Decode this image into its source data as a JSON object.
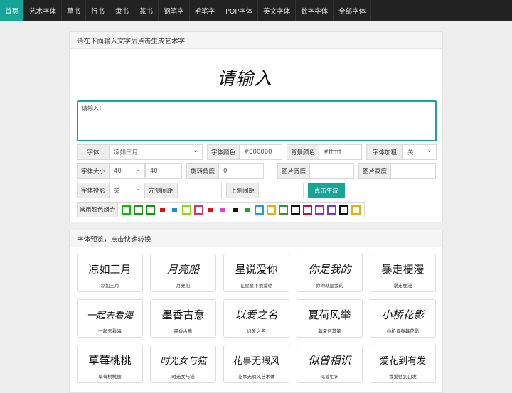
{
  "nav": {
    "items": [
      {
        "label": "首页",
        "active": true
      },
      {
        "label": "艺术字体",
        "active": false
      },
      {
        "label": "草书",
        "active": false
      },
      {
        "label": "行书",
        "active": false
      },
      {
        "label": "隶书",
        "active": false
      },
      {
        "label": "篆书",
        "active": false
      },
      {
        "label": "钢笔字",
        "active": false
      },
      {
        "label": "毛笔字",
        "active": false
      },
      {
        "label": "POP字体",
        "active": false
      },
      {
        "label": "英文字体",
        "active": false
      },
      {
        "label": "数字字体",
        "active": false
      },
      {
        "label": "全部字体",
        "active": false
      }
    ]
  },
  "generator": {
    "heading": "请在下面输入文字后点击生成艺术字",
    "preview_text": "请输入",
    "input_placeholder": "请输入！",
    "font_label": "字体",
    "font_value": "凉如三月",
    "font_color_label": "字体颜色",
    "font_color_value": "#000000",
    "bg_color_label": "背景颜色",
    "bg_color_value": "#ffffff",
    "bold_label": "字体加粗",
    "bold_value": "关",
    "size_label": "字体大小",
    "size_select": "40",
    "size_value": "40",
    "rotate_label": "旋转角度",
    "rotate_value": "0",
    "img_width_label": "图片宽度",
    "img_width_value": "",
    "img_height_label": "图片高度",
    "img_height_value": "",
    "shadow_label": "字体投影",
    "shadow_value": "关",
    "left_spacing_label": "左侧间距",
    "left_spacing_value": "",
    "top_spacing_label": "上侧间距",
    "top_spacing_value": "",
    "generate_button": "点击生成",
    "combo_label": "常用颜色组合",
    "swatches": [
      {
        "kind": "box",
        "color": "#00c000"
      },
      {
        "kind": "box",
        "color": "#1a9a1a"
      },
      {
        "kind": "box",
        "color": "#00a000"
      },
      {
        "kind": "solid",
        "color": "#e01010"
      },
      {
        "kind": "solid",
        "color": "#1a8fd0"
      },
      {
        "kind": "box",
        "color": "#8ae000"
      },
      {
        "kind": "box",
        "color": "#e0306a"
      },
      {
        "kind": "solid",
        "color": "#e01010"
      },
      {
        "kind": "solid",
        "color": "#e040e0"
      },
      {
        "kind": "solid",
        "color": "#111111"
      },
      {
        "kind": "solid",
        "color": "#2aa02a"
      },
      {
        "kind": "box",
        "color": "#1aa0e0"
      },
      {
        "kind": "box",
        "color": "#e8b000"
      },
      {
        "kind": "box",
        "color": "#2a9a2a"
      },
      {
        "kind": "box",
        "color": "#111111"
      },
      {
        "kind": "box",
        "color": "#c0104a"
      },
      {
        "kind": "box",
        "color": "#b020b0"
      },
      {
        "kind": "box",
        "color": "#8030d0"
      },
      {
        "kind": "box",
        "color": "#111111"
      },
      {
        "kind": "box",
        "color": "#e8b000"
      }
    ]
  },
  "gallery": {
    "heading": "字体预览，点击快速转换",
    "fonts": [
      {
        "sample": "凉如三月",
        "name": "凉如三月"
      },
      {
        "sample": "月亮船",
        "name": "月亮船"
      },
      {
        "sample": "星说爱你",
        "name": "在星星下说爱你"
      },
      {
        "sample": "你是我的",
        "name": "你的就是我的"
      },
      {
        "sample": "暴走梗漫",
        "name": "暴走梗漫"
      },
      {
        "sample": "一起去看海",
        "name": "一起去看海"
      },
      {
        "sample": "墨香古意",
        "name": "墨香古意"
      },
      {
        "sample": "以爱之名",
        "name": "以爱之名"
      },
      {
        "sample": "夏荷风举",
        "name": "暮夏何其擎"
      },
      {
        "sample": "小桥花影",
        "name": "小桥青春暮花影"
      },
      {
        "sample": "草莓桃桃",
        "name": "草莓桃桃熊"
      },
      {
        "sample": "时光女与猫",
        "name": "时光女与猫"
      },
      {
        "sample": "花事无暇风",
        "name": "花事无暇风艺术体"
      },
      {
        "sample": "似曾相识",
        "name": "似曾相识"
      },
      {
        "sample": "爱花到有发",
        "name": "我爱他到白发"
      }
    ]
  }
}
